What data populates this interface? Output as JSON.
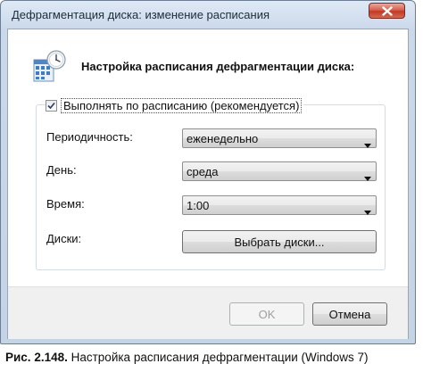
{
  "window": {
    "title": "Дефрагментация диска: изменение расписания"
  },
  "header": {
    "heading": "Настройка расписания дефрагментации диска:"
  },
  "schedule": {
    "checkbox_label": "Выполнять по расписанию (рекомендуется)",
    "checked": true
  },
  "fields": {
    "frequency": {
      "label": "Периодичность:",
      "value": "еженедельно"
    },
    "day": {
      "label": "День:",
      "value": "среда"
    },
    "time": {
      "label": "Время:",
      "value": "1:00"
    },
    "disks": {
      "label": "Диски:",
      "button_label": "Выбрать диски..."
    }
  },
  "buttons": {
    "ok_label": "OK",
    "cancel_label": "Отмена"
  },
  "caption": {
    "number": "Рис. 2.148.",
    "text": " Настройка расписания дефрагментации (Windows 7)"
  },
  "icons": {
    "close": "close-icon",
    "dropdown": "chevron-down-icon",
    "header": "disk-defrag-schedule-icon",
    "check": "checkmark-icon"
  }
}
